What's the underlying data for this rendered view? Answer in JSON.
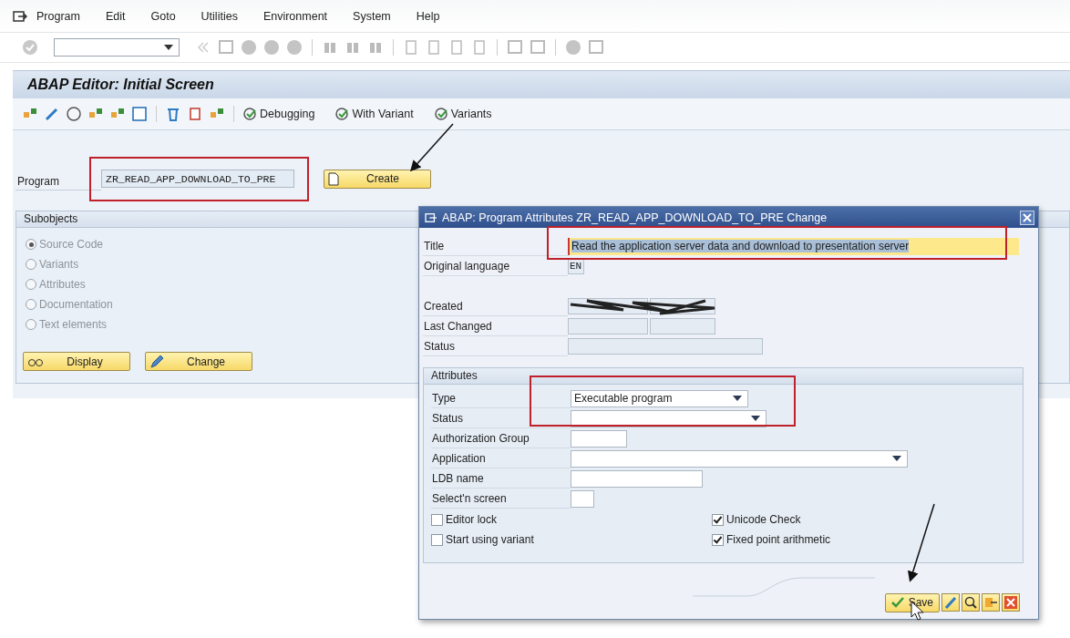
{
  "menu": [
    {
      "label": "Program"
    },
    {
      "label": "Edit"
    },
    {
      "label": "Goto"
    },
    {
      "label": "Utilities"
    },
    {
      "label": "Environment"
    },
    {
      "label": "System"
    },
    {
      "label": "Help"
    }
  ],
  "title": "ABAP Editor: Initial Screen",
  "app_toolbar": [
    {
      "label": "Debugging"
    },
    {
      "label": "With Variant"
    },
    {
      "label": "Variants"
    }
  ],
  "program": {
    "label": "Program",
    "value": "ZR_READ_APP_DOWNLOAD_TO_PRE"
  },
  "create_button": "Create",
  "subobjects": {
    "title": "Subobjects",
    "options": [
      {
        "label": "Source Code",
        "selected": true,
        "disabled": true
      },
      {
        "label": "Variants",
        "selected": false,
        "disabled": true
      },
      {
        "label": "Attributes",
        "selected": false,
        "disabled": true
      },
      {
        "label": "Documentation",
        "selected": false,
        "disabled": true
      },
      {
        "label": "Text elements",
        "selected": false,
        "disabled": true
      }
    ],
    "buttons": [
      {
        "label": "Display",
        "kind": "display"
      },
      {
        "label": "Change",
        "kind": "change"
      }
    ]
  },
  "dialog": {
    "title": "ABAP: Program Attributes ZR_READ_APP_DOWNLOAD_TO_PRE Change",
    "fields": [
      {
        "label": "Title",
        "kind": "title",
        "value": "Read the application server data and download to presentation server"
      },
      {
        "label": "Original language",
        "kind": "short",
        "value": "EN"
      }
    ],
    "dates": [
      {
        "label": "Created",
        "kind": "redacted"
      },
      {
        "label": "Last Changed",
        "kind": "pair"
      },
      {
        "label": "Status",
        "kind": "wide"
      }
    ],
    "attributes": {
      "title": "Attributes",
      "fields": [
        {
          "label": "Type",
          "kind": "dropdown",
          "value": "Executable program"
        },
        {
          "label": "Status",
          "kind": "dropdown"
        },
        {
          "label": "Authorization Group",
          "kind": "input"
        },
        {
          "label": "Application",
          "kind": "dropdown"
        },
        {
          "label": "LDB name",
          "kind": "input"
        },
        {
          "label": "Select'n screen",
          "kind": "input"
        }
      ],
      "checkboxes": [
        {
          "label": "Editor lock",
          "checked": false
        },
        {
          "label": "Unicode Check",
          "checked": true
        },
        {
          "label": "Start using variant",
          "checked": false
        },
        {
          "label": "Fixed point arithmetic",
          "checked": true
        }
      ]
    },
    "save_button": "Save"
  }
}
